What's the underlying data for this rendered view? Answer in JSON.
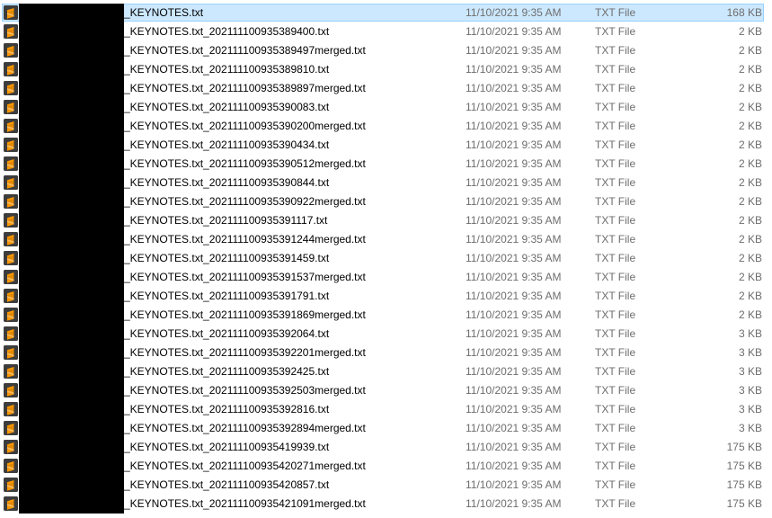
{
  "files": [
    {
      "name": "_KEYNOTES.txt",
      "date": "11/10/2021 9:35 AM",
      "type": "TXT File",
      "size": "168 KB",
      "selected": true
    },
    {
      "name": "_KEYNOTES.txt_202111100935389400.txt",
      "date": "11/10/2021 9:35 AM",
      "type": "TXT File",
      "size": "2 KB"
    },
    {
      "name": "_KEYNOTES.txt_202111100935389497merged.txt",
      "date": "11/10/2021 9:35 AM",
      "type": "TXT File",
      "size": "2 KB"
    },
    {
      "name": "_KEYNOTES.txt_202111100935389810.txt",
      "date": "11/10/2021 9:35 AM",
      "type": "TXT File",
      "size": "2 KB"
    },
    {
      "name": "_KEYNOTES.txt_202111100935389897merged.txt",
      "date": "11/10/2021 9:35 AM",
      "type": "TXT File",
      "size": "2 KB"
    },
    {
      "name": "_KEYNOTES.txt_202111100935390083.txt",
      "date": "11/10/2021 9:35 AM",
      "type": "TXT File",
      "size": "2 KB"
    },
    {
      "name": "_KEYNOTES.txt_202111100935390200merged.txt",
      "date": "11/10/2021 9:35 AM",
      "type": "TXT File",
      "size": "2 KB"
    },
    {
      "name": "_KEYNOTES.txt_202111100935390434.txt",
      "date": "11/10/2021 9:35 AM",
      "type": "TXT File",
      "size": "2 KB"
    },
    {
      "name": "_KEYNOTES.txt_202111100935390512merged.txt",
      "date": "11/10/2021 9:35 AM",
      "type": "TXT File",
      "size": "2 KB"
    },
    {
      "name": "_KEYNOTES.txt_202111100935390844.txt",
      "date": "11/10/2021 9:35 AM",
      "type": "TXT File",
      "size": "2 KB"
    },
    {
      "name": "_KEYNOTES.txt_202111100935390922merged.txt",
      "date": "11/10/2021 9:35 AM",
      "type": "TXT File",
      "size": "2 KB"
    },
    {
      "name": "_KEYNOTES.txt_202111100935391117.txt",
      "date": "11/10/2021 9:35 AM",
      "type": "TXT File",
      "size": "2 KB"
    },
    {
      "name": "_KEYNOTES.txt_202111100935391244merged.txt",
      "date": "11/10/2021 9:35 AM",
      "type": "TXT File",
      "size": "2 KB"
    },
    {
      "name": "_KEYNOTES.txt_202111100935391459.txt",
      "date": "11/10/2021 9:35 AM",
      "type": "TXT File",
      "size": "2 KB"
    },
    {
      "name": "_KEYNOTES.txt_202111100935391537merged.txt",
      "date": "11/10/2021 9:35 AM",
      "type": "TXT File",
      "size": "2 KB"
    },
    {
      "name": "_KEYNOTES.txt_202111100935391791.txt",
      "date": "11/10/2021 9:35 AM",
      "type": "TXT File",
      "size": "2 KB"
    },
    {
      "name": "_KEYNOTES.txt_202111100935391869merged.txt",
      "date": "11/10/2021 9:35 AM",
      "type": "TXT File",
      "size": "2 KB"
    },
    {
      "name": "_KEYNOTES.txt_202111100935392064.txt",
      "date": "11/10/2021 9:35 AM",
      "type": "TXT File",
      "size": "3 KB"
    },
    {
      "name": "_KEYNOTES.txt_202111100935392201merged.txt",
      "date": "11/10/2021 9:35 AM",
      "type": "TXT File",
      "size": "3 KB"
    },
    {
      "name": "_KEYNOTES.txt_202111100935392425.txt",
      "date": "11/10/2021 9:35 AM",
      "type": "TXT File",
      "size": "3 KB"
    },
    {
      "name": "_KEYNOTES.txt_202111100935392503merged.txt",
      "date": "11/10/2021 9:35 AM",
      "type": "TXT File",
      "size": "3 KB"
    },
    {
      "name": "_KEYNOTES.txt_202111100935392816.txt",
      "date": "11/10/2021 9:35 AM",
      "type": "TXT File",
      "size": "3 KB"
    },
    {
      "name": "_KEYNOTES.txt_202111100935392894merged.txt",
      "date": "11/10/2021 9:35 AM",
      "type": "TXT File",
      "size": "3 KB"
    },
    {
      "name": "_KEYNOTES.txt_202111100935419939.txt",
      "date": "11/10/2021 9:35 AM",
      "type": "TXT File",
      "size": "175 KB"
    },
    {
      "name": "_KEYNOTES.txt_202111100935420271merged.txt",
      "date": "11/10/2021 9:35 AM",
      "type": "TXT File",
      "size": "175 KB"
    },
    {
      "name": "_KEYNOTES.txt_202111100935420857.txt",
      "date": "11/10/2021 9:35 AM",
      "type": "TXT File",
      "size": "175 KB"
    },
    {
      "name": "_KEYNOTES.txt_202111100935421091merged.txt",
      "date": "11/10/2021 9:35 AM",
      "type": "TXT File",
      "size": "175 KB"
    }
  ],
  "icon": "sublime-text-file-icon",
  "colors": {
    "selection_bg": "#cce8ff",
    "selection_border": "#99d1ff",
    "icon_accent": "#ff9800",
    "secondary_text": "#6d6d6d"
  }
}
